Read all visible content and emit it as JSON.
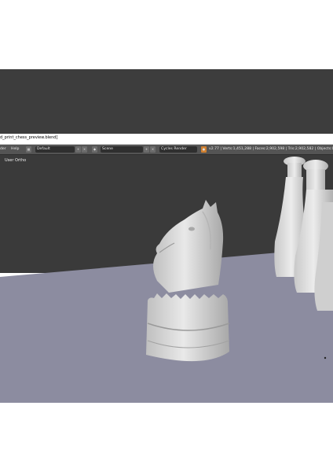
{
  "window": {
    "title": "d_print_chess_preview.blend]"
  },
  "header": {
    "menu_render": "der",
    "menu_help": "Help",
    "screen_layout": "Default",
    "scene": "Scene",
    "render_engine": "Cycles Render",
    "stats": "v2.77 | Verts:1,451,288 | Faces:2,902,598 | Tris:2,902,582 | Objects:0/"
  },
  "viewport": {
    "view_label": "User Ortho"
  },
  "colors": {
    "header_bg": "#545454",
    "viewport_bg": "#3a3a3a",
    "floor": "#8c8ca0",
    "piece": "#dcdcdc"
  }
}
